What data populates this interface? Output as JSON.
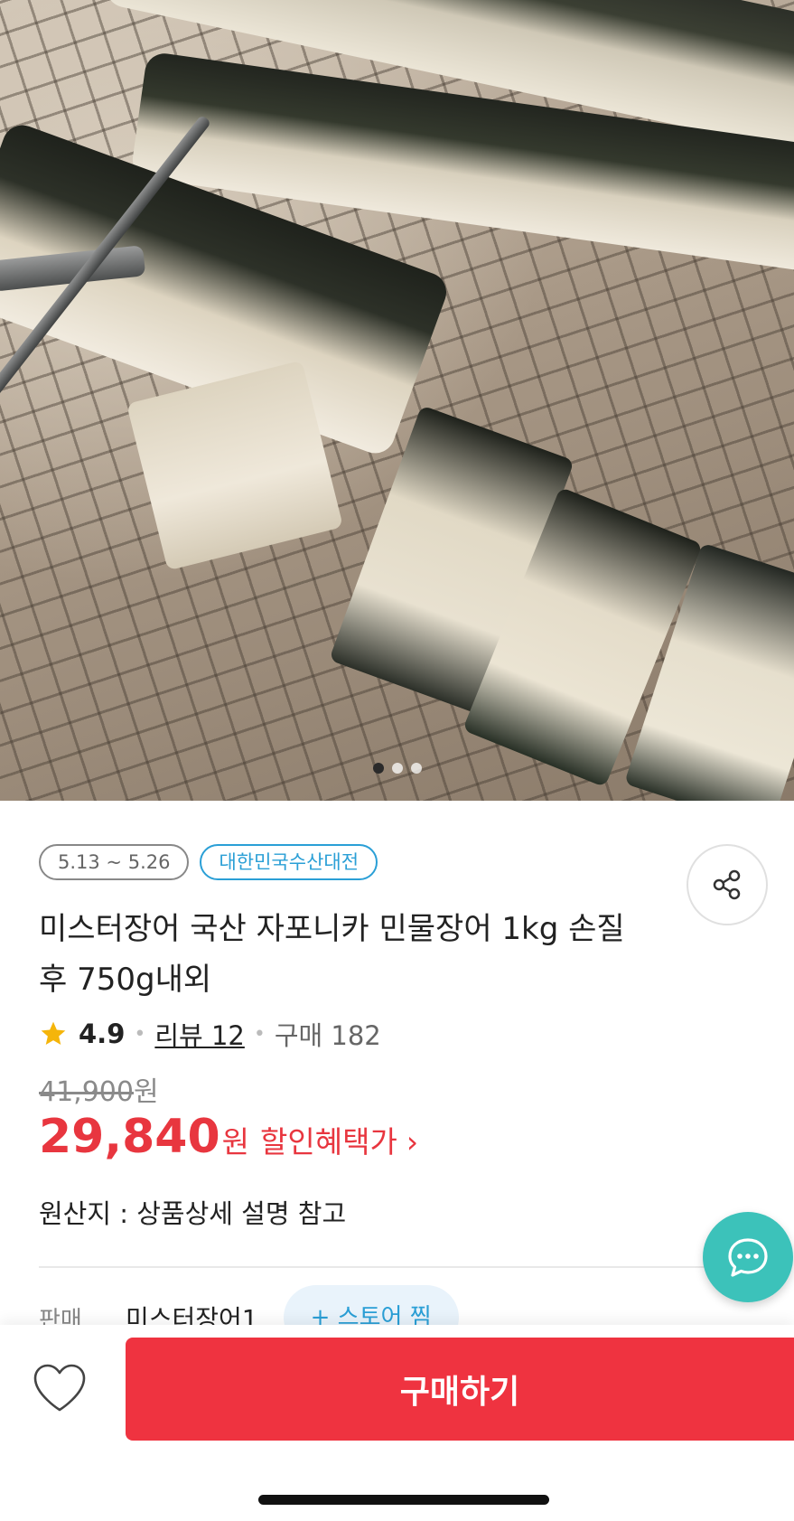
{
  "hero": {
    "image_description_icon": "grilled-eel-photo",
    "carousel": {
      "total": 3,
      "active_index": 0
    }
  },
  "badges": [
    {
      "label": "5.13 ~ 5.26"
    },
    {
      "label": "대한민국수산대전"
    }
  ],
  "product": {
    "title": "미스터장어 국산 자포니카 민물장어 1kg 손질 후 750g내외",
    "rating": "4.9",
    "review_label": "리뷰 12",
    "purchase_label": "구매 182",
    "original_price": "41,900",
    "original_price_unit": "원",
    "sale_price": "29,840",
    "sale_price_unit": "원",
    "sale_label": "할인혜택가",
    "sale_chevron": "›",
    "origin": "원산지 : 상품상세 설명 참고"
  },
  "seller": {
    "label": "판매",
    "name": "미스터장어1",
    "store_button": "+ 스토어 찜"
  },
  "bottom_bar": {
    "buy_label": "구매하기"
  },
  "colors": {
    "accent_red": "#ef3340",
    "price_red": "#e8363f",
    "badge_blue": "#2a9fd6",
    "chat_teal": "#3cc2ba",
    "star_yellow": "#f5b50a"
  }
}
